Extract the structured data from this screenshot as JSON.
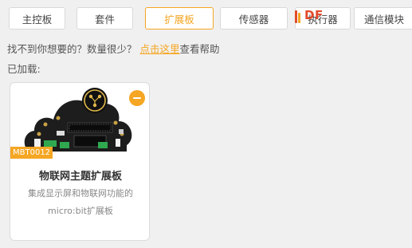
{
  "tabs": [
    {
      "label": "主控板",
      "active": false
    },
    {
      "label": "套件",
      "active": false
    },
    {
      "label": "扩展板",
      "active": true
    },
    {
      "label": "传感器",
      "active": false
    },
    {
      "label": "执行器",
      "active": false
    },
    {
      "label": "通信模块",
      "active": false
    }
  ],
  "watermark": {
    "text": "DF"
  },
  "help": {
    "prefix": "找不到你想要的？数量很少？",
    "link": "点击这里",
    "suffix": "查看帮助"
  },
  "loaded_label": "已加载:",
  "cards": [
    {
      "sku": "MBT0012",
      "title": "物联网主题扩展板",
      "desc_line1": "集成显示屏和物联网功能的",
      "desc_line2": "micro:bit扩展板"
    }
  ],
  "colors": {
    "accent": "#f5a623",
    "logo": "#e24a2a"
  }
}
